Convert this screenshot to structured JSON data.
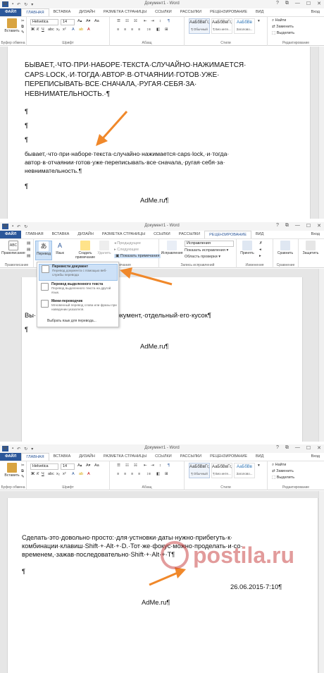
{
  "app": {
    "title": "Документ1 - Word",
    "logo": "W",
    "signin": "Вход",
    "window_controls": [
      "?",
      "⧉",
      "—",
      "☐",
      "✕"
    ]
  },
  "tabs": [
    "ФАЙЛ",
    "ГЛАВНАЯ",
    "ВСТАВКА",
    "ДИЗАЙН",
    "РАЗМЕТКА СТРАНИЦЫ",
    "ССЫЛКИ",
    "РАССЫЛКИ",
    "РЕЦЕНЗИРОВАНИЕ",
    "ВИД"
  ],
  "home_ribbon": {
    "paste": "Вставить",
    "font_name": "Helvetica",
    "font_size": "14",
    "format_buttons": [
      "Ж",
      "К",
      "Ч"
    ],
    "styles": [
      {
        "sample": "АаБбВвГг,",
        "name": "¶ Обычный"
      },
      {
        "sample": "АаБбВвГг,",
        "name": "¶ Без инте..."
      },
      {
        "sample": "АаБбВв",
        "name": "Заголово..."
      }
    ],
    "find": "Найти",
    "replace": "Заменить",
    "select": "Выделить",
    "groups": [
      "Буфер обмена",
      "Шрифт",
      "Абзац",
      "Стили",
      "Редактирование"
    ]
  },
  "review_ribbon": {
    "spelling": "Правописание",
    "translate": "Перевод",
    "language": "Язык",
    "new_comment": "Создать примечание",
    "delete": "Удалить",
    "previous": "Предыдущее",
    "next": "Следующее",
    "show_comments": "Показать примечания",
    "track_changes": "Исправления",
    "markup_combo": "Исправления",
    "show_markup": "Показать исправления",
    "reviewing_pane": "Область проверки",
    "accept": "Принять",
    "compare": "Сравнить",
    "protect": "Защитить",
    "groups": [
      "Правописание",
      "мечания",
      "Запись исправлений",
      "Изменения",
      "Сравнение"
    ]
  },
  "translate_menu": {
    "items": [
      {
        "title": "Перевести документ",
        "desc": "Перевод документа с помощью веб-службы перевода"
      },
      {
        "title": "Перевод выделенного текста",
        "desc": "Перевод выделенного текста на другой язык."
      },
      {
        "title": "Мини-переводчик",
        "desc": "Мгновенный перевод слова или фразы при наведении указателя."
      }
    ],
    "choose_language": "Выбрать язык для перевода..."
  },
  "panel1": {
    "upper_lines": [
      "БЫВАЕТ,·ЧТО·ПРИ·НАБОРЕ·ТЕКСТА·СЛУЧАЙНО·НАЖИМАЕТСЯ·",
      "CAPS·LOCK,·И·ТОГДА·АВТОР·В·ОТЧАЯНИИ·ГОТОВ·УЖЕ·",
      "ПЕРЕПИСЫВАТЬ·ВСЕ·СНАЧАЛА,·РУГАЯ·СЕБЯ·ЗА·",
      "НЕВНИМАТЕЛЬНОСТЬ.·¶"
    ],
    "para_marks": [
      "¶",
      "¶",
      "¶"
    ],
    "lower_lines": [
      "бывает,·что·при·наборе·текста·случайно·нажимается·caps·lock,·и·тогда·",
      "автор·в·отчаянии·готов·уже·переписывать·все·сначала,·ругая·себя·за·",
      "невнимательность.¶"
    ],
    "end_mark": "¶",
    "footer": "AdMe.ru¶"
  },
  "panel2": {
    "text": "Вы·  можете·перевести·весь·документ,·отдельный·его·кусок¶",
    "mark": "¶",
    "footer": "AdMe.ru¶"
  },
  "panel3": {
    "lines": [
      "Сделать·это·довольно·просто:·для·устновки·даты·нужно·прибегуть·к·",
      "комбинации·клавиш·Shift·+·Alt·+·D.·Тот·же·фокус·можно·проделать·и·со·",
      "временем,·зажав·последовательно·Shift·+·Alt·+·T¶"
    ],
    "mark": "¶",
    "date": "26.06.2015·7:10¶",
    "footer": "AdMe.ru¶"
  },
  "watermark": "postila.ru",
  "colors": {
    "word_blue": "#2b579a",
    "arrow": "#f0882a",
    "ribbon_border": "#d5d5d5",
    "highlight": "#cde1f7"
  }
}
